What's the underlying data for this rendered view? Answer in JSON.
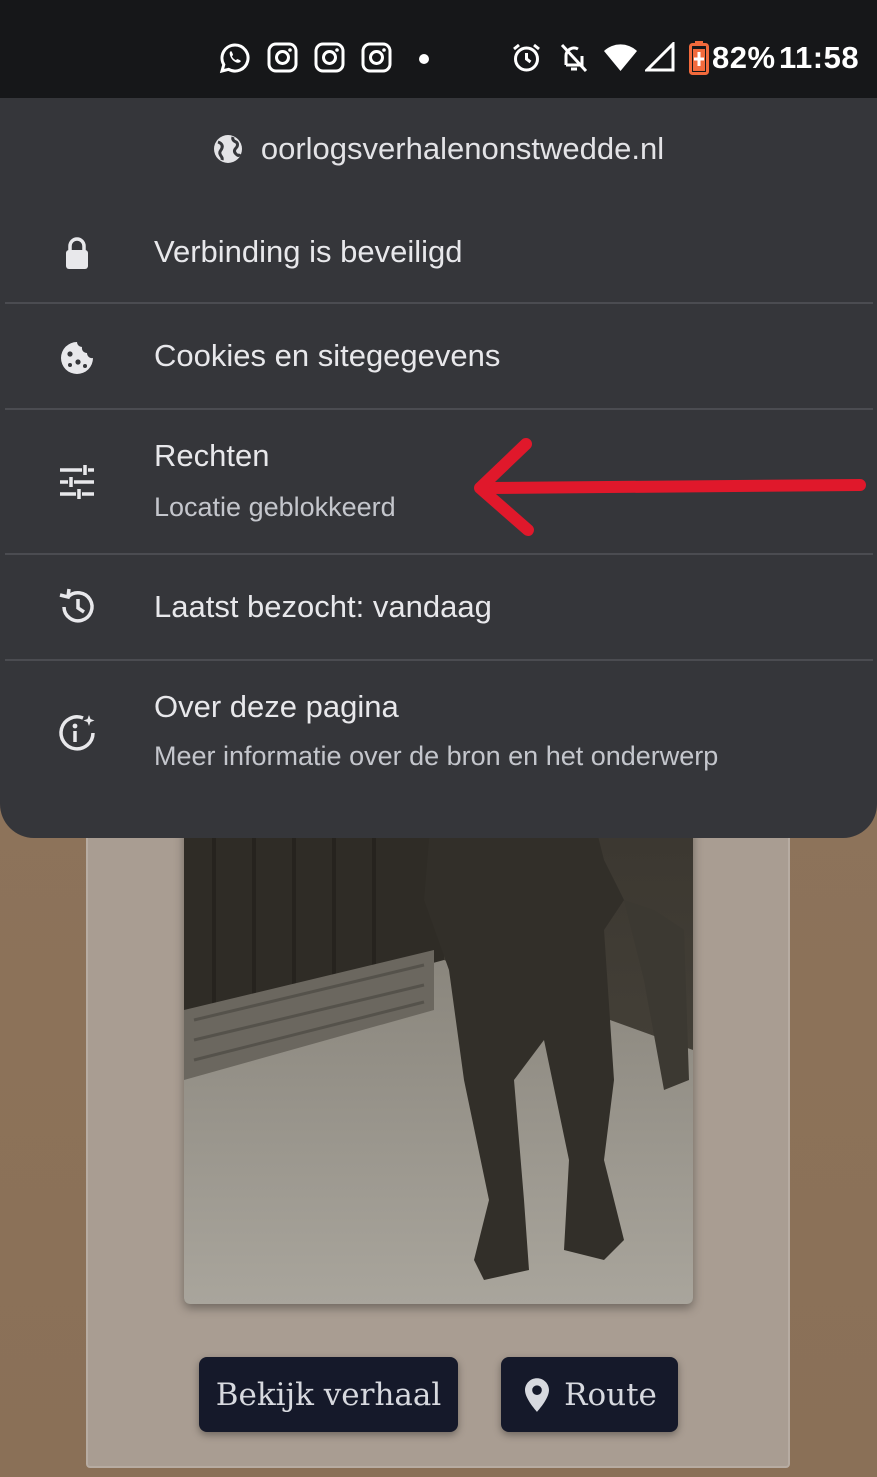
{
  "status_bar": {
    "battery": "82%",
    "time": "11:58",
    "icons": [
      "whatsapp-icon",
      "instagram-icon",
      "instagram-icon",
      "instagram-icon",
      "dot-icon",
      "alarm-icon",
      "bell-off-icon",
      "wifi-icon",
      "signal-icon",
      "battery-icon"
    ]
  },
  "site_info": {
    "domain": "oorlogsverhalenonstwedde.nl",
    "items": [
      {
        "icon": "lock-icon",
        "title": "Verbinding is beveiligd",
        "subtitle": ""
      },
      {
        "icon": "cookie-icon",
        "title": "Cookies en sitegegevens",
        "subtitle": ""
      },
      {
        "icon": "tune-icon",
        "title": "Rechten",
        "subtitle": "Locatie geblokkeerd"
      },
      {
        "icon": "history-icon",
        "title": "Laatst bezocht: vandaag",
        "subtitle": ""
      },
      {
        "icon": "info-sparkle-icon",
        "title": "Over deze pagina",
        "subtitle": "Meer informatie over de bron en het onderwerp"
      }
    ]
  },
  "page": {
    "story_button": "Bekijk verhaal",
    "route_button": "Route"
  },
  "colors": {
    "sheet_bg": "#35363a",
    "annotation_arrow": "#e0182b",
    "button_bg": "#15192a",
    "page_bg": "#8b7158"
  }
}
